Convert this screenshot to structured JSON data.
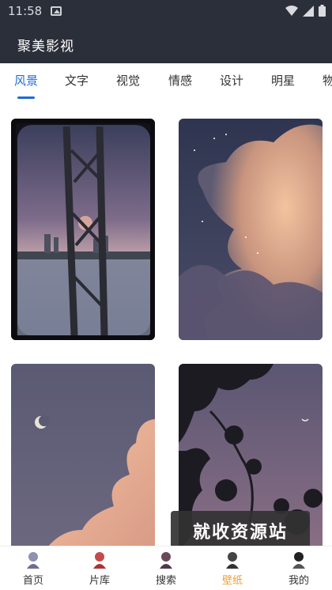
{
  "status_bar": {
    "time": "11:58"
  },
  "app": {
    "title": "聚美影视"
  },
  "tabs": [
    {
      "label": "风景"
    },
    {
      "label": "文字"
    },
    {
      "label": "视觉"
    },
    {
      "label": "情感"
    },
    {
      "label": "设计"
    },
    {
      "label": "明星"
    },
    {
      "label": "物"
    }
  ],
  "wallpapers": [
    {
      "name": "window-sunset"
    },
    {
      "name": "clouds-night"
    },
    {
      "name": "moon-clouds"
    },
    {
      "name": "tree-silhouette"
    }
  ],
  "watermark": {
    "text": "就收资源站"
  },
  "bottom_nav": [
    {
      "label": "首页"
    },
    {
      "label": "片库"
    },
    {
      "label": "搜索"
    },
    {
      "label": "壁纸"
    },
    {
      "label": "我的"
    }
  ],
  "colors": {
    "accent": "#1e6bd6",
    "active_nav": "#e6a23c",
    "header_bg": "#2b2f3a"
  }
}
